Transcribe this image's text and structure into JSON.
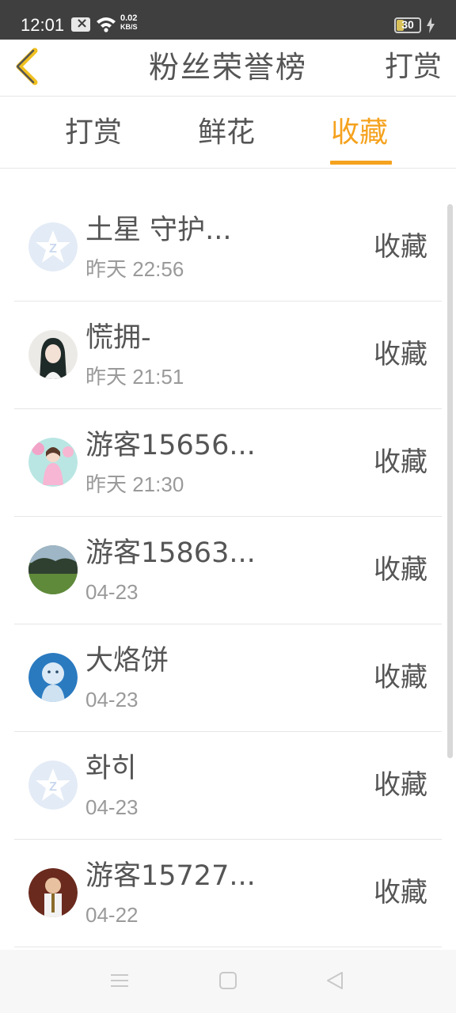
{
  "status_bar": {
    "time": "12:01",
    "net_speed": "0.02",
    "net_unit": "KB/S",
    "battery": "30"
  },
  "header": {
    "title": "粉丝荣誉榜",
    "action_label": "打赏"
  },
  "tabs": [
    {
      "label": "打赏",
      "active": false
    },
    {
      "label": "鲜花",
      "active": false
    },
    {
      "label": "收藏",
      "active": true
    }
  ],
  "list": [
    {
      "name": "土星 守护...",
      "time": "昨天 22:56",
      "action": "收藏",
      "avatar": "default-avatar"
    },
    {
      "name": "慌拥-",
      "time": "昨天 21:51",
      "action": "收藏",
      "avatar": "photo-girl-dark-hair"
    },
    {
      "name": "游客15656...",
      "time": "昨天 21:30",
      "action": "收藏",
      "avatar": "photo-girl-pink"
    },
    {
      "name": "游客15863...",
      "time": "04-23",
      "action": "收藏",
      "avatar": "photo-landscape"
    },
    {
      "name": "大烙饼",
      "time": "04-23",
      "action": "收藏",
      "avatar": "photo-blue-doll"
    },
    {
      "name": "화히",
      "time": "04-23",
      "action": "收藏",
      "avatar": "default-avatar"
    },
    {
      "name": "游客15727...",
      "time": "04-22",
      "action": "收藏",
      "avatar": "photo-child"
    }
  ],
  "colors": {
    "accent": "#f5a21e",
    "status_bar_bg": "#3f3f3f",
    "text": "#555555",
    "muted_text": "#9a9a9a"
  }
}
